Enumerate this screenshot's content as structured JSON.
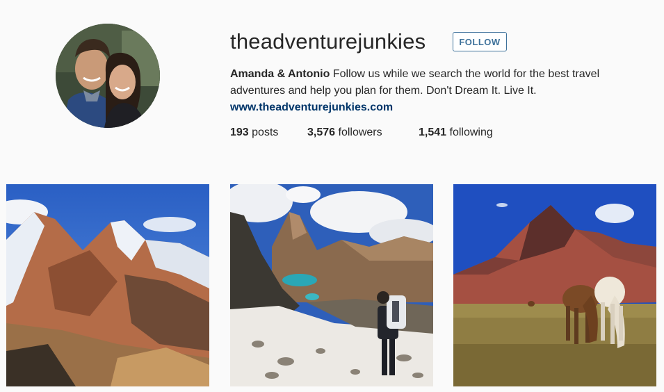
{
  "profile": {
    "username": "theadventurejunkies",
    "follow_label": "FOLLOW",
    "bio_name": "Amanda & Antonio",
    "bio_text": " Follow us while we search the world for the best travel adventures and help you plan for them. Don't Dream It. Live It.",
    "website": "www.theadventurejunkies.com",
    "accent_color": "#3f729b",
    "link_color": "#003569"
  },
  "stats": {
    "posts_count": "193",
    "posts_label": " posts",
    "followers_count": "3,576",
    "followers_label": " followers",
    "following_count": "1,541",
    "following_label": " following"
  },
  "posts": [
    {
      "subject": "snowy mountain range under blue sky"
    },
    {
      "subject": "hiker overlooking turquoise lake in mountains"
    },
    {
      "subject": "horses grazing below red mountain"
    }
  ]
}
